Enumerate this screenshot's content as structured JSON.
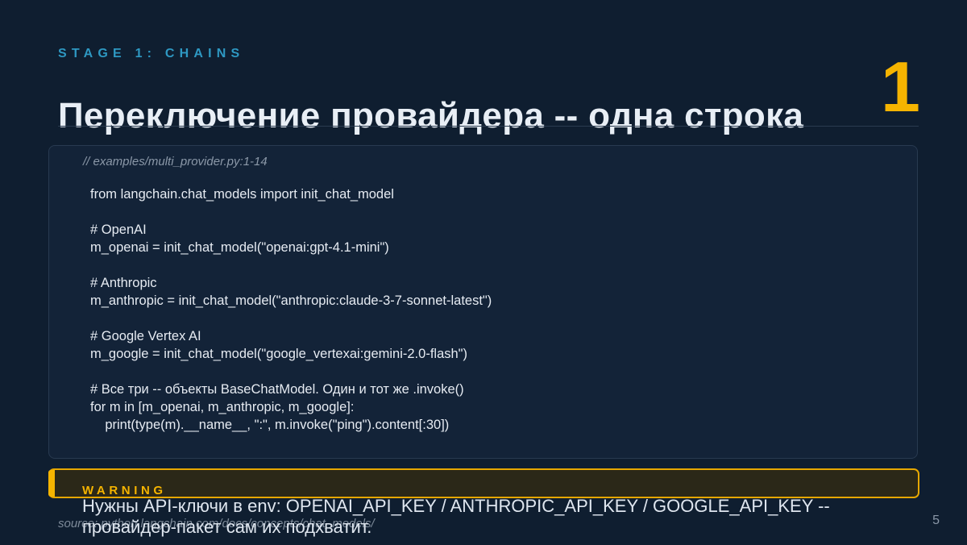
{
  "header": {
    "eyebrow": "STAGE 1: CHAINS",
    "stage_number": "1",
    "title": "Переключение провайдера -- одна строка"
  },
  "code": {
    "source": "// examples/multi_provider.py:1-14",
    "lines": [
      "from langchain.chat_models import init_chat_model",
      "",
      "# OpenAI",
      "m_openai = init_chat_model(\"openai:gpt-4.1-mini\")",
      "",
      "# Anthropic",
      "m_anthropic = init_chat_model(\"anthropic:claude-3-7-sonnet-latest\")",
      "",
      "# Google Vertex AI",
      "m_google = init_chat_model(\"google_vertexai:gemini-2.0-flash\")",
      "",
      "# Все три -- объекты BaseChatModel. Один и тот же .invoke()",
      "for m in [m_openai, m_anthropic, m_google]:",
      "    print(type(m).__name__, \":\", m.invoke(\"ping\").content[:30])"
    ]
  },
  "warning": {
    "label": "WARNING",
    "text_line1": "Нужны API-ключи в env: OPENAI_API_KEY / ANTHROPIC_API_KEY / GOOGLE_API_KEY --",
    "text_line2": "провайдер-пакет сам их подхватит."
  },
  "footer": {
    "source": "source: python.langchain.com/docs/concepts/chat_models/",
    "page_number": "5"
  },
  "colors": {
    "background": "#0f1e30",
    "accent_blue": "#2e98c2",
    "accent_yellow": "#f5b400"
  }
}
